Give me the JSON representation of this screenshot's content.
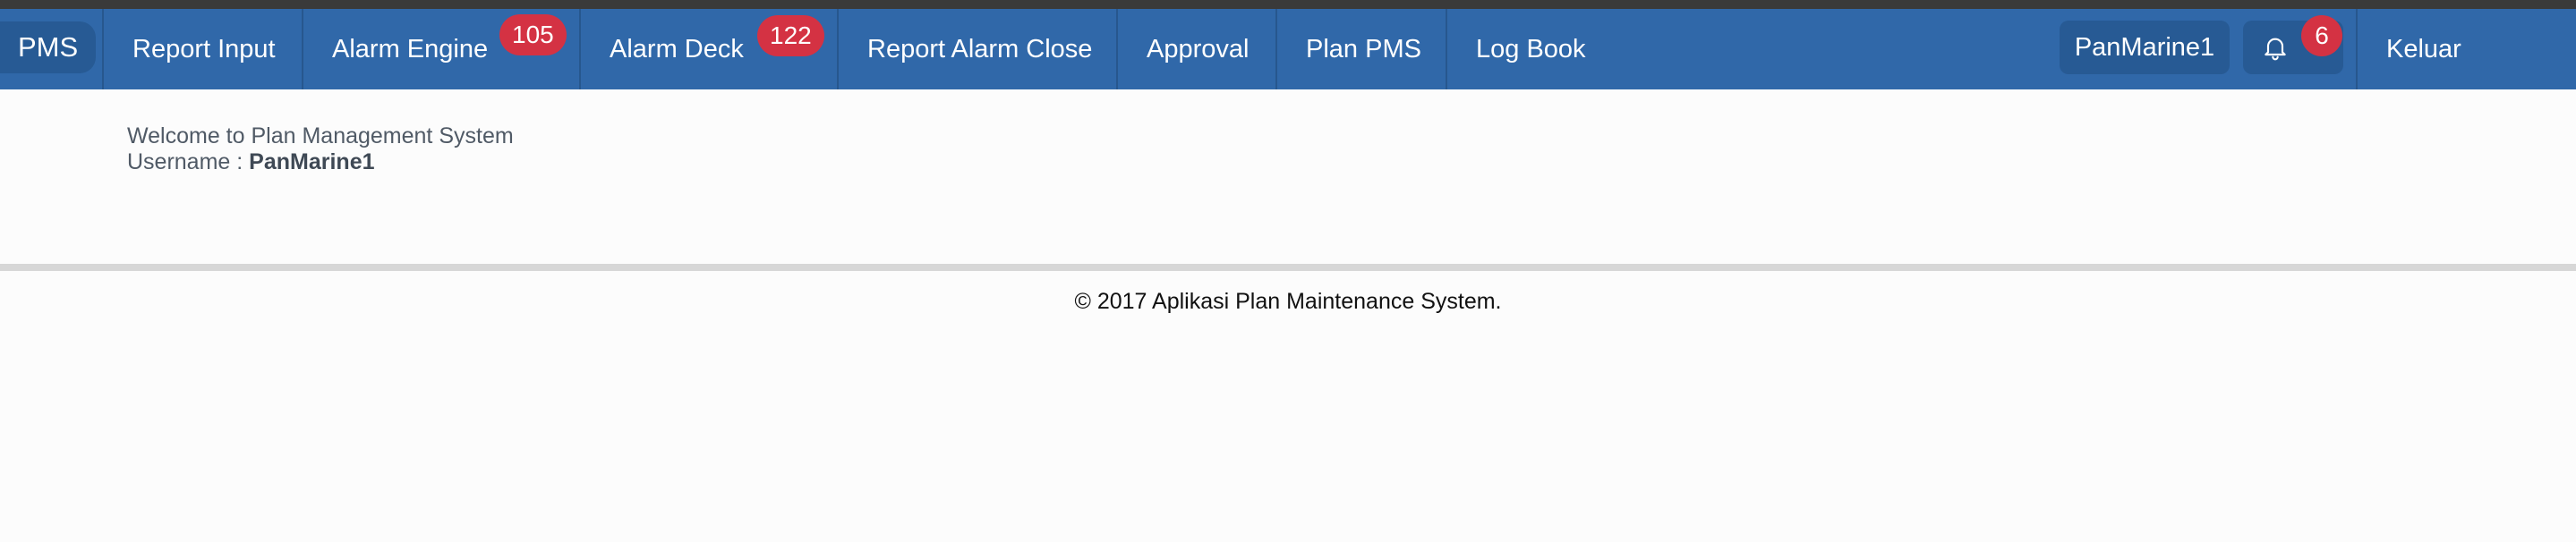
{
  "navbar": {
    "brand": "PMS",
    "items": [
      {
        "label": "Report Input"
      },
      {
        "label": "Alarm Engine",
        "badge": "105"
      },
      {
        "label": "Alarm Deck",
        "badge": "122"
      },
      {
        "label": "Report Alarm Close"
      },
      {
        "label": "Approval"
      },
      {
        "label": "Plan PMS"
      },
      {
        "label": "Log Book"
      }
    ],
    "user": "PanMarine1",
    "notifications_count": "6",
    "logout": "Keluar"
  },
  "main": {
    "welcome": "Welcome to Plan Management System",
    "username_label": "Username : ",
    "username": "PanMarine1"
  },
  "footer": {
    "text": "© 2017 Aplikasi Plan Maintenance System."
  },
  "colors": {
    "navbar": "#3068a9",
    "navbar_dark": "#275a94",
    "badge": "#d43243"
  },
  "icons": {
    "bell": "bell-icon"
  }
}
